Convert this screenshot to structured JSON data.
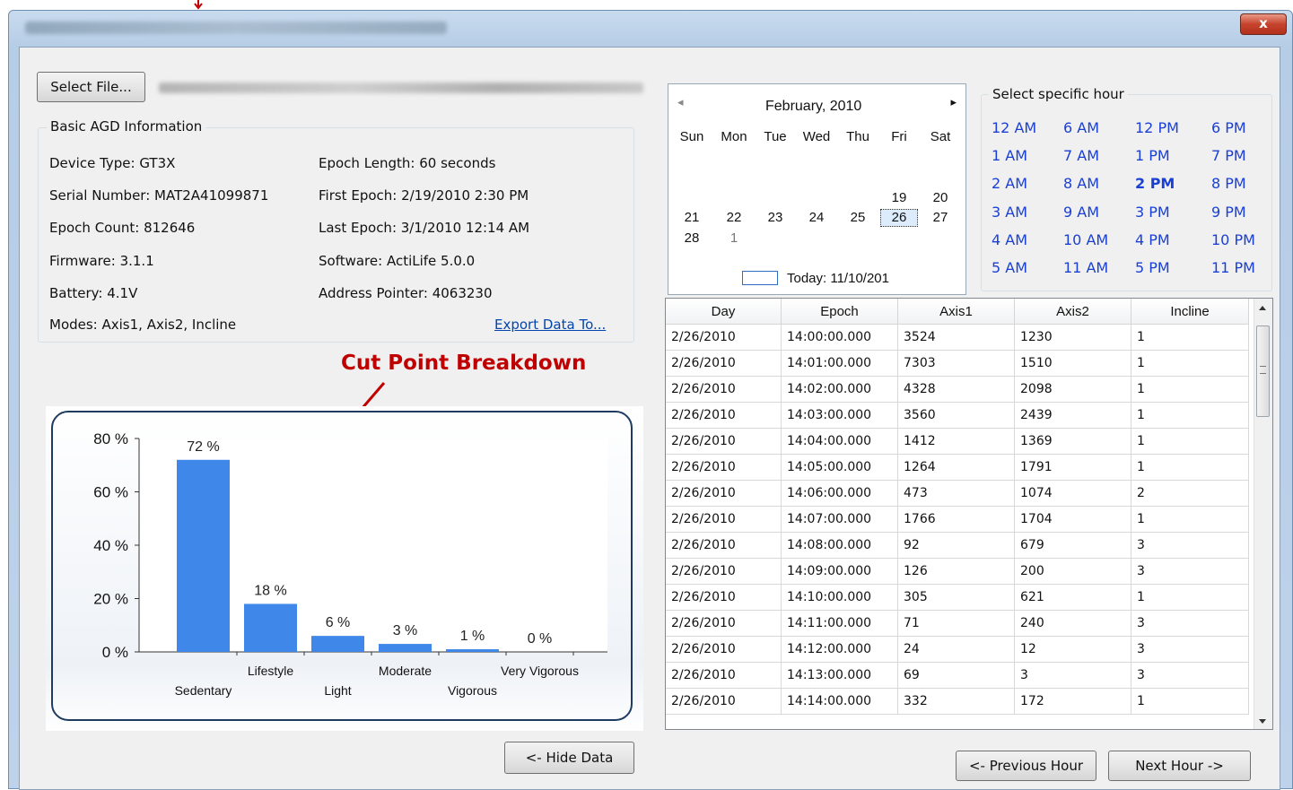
{
  "window": {
    "close_label": "x"
  },
  "file": {
    "select_label": "Select File..."
  },
  "info": {
    "legend": "Basic AGD Information",
    "device_type": "Device Type: GT3X",
    "serial_number": "Serial Number: MAT2A41099871",
    "epoch_count": "Epoch Count: 812646",
    "firmware": "Firmware: 3.1.1",
    "battery": "Battery: 4.1V",
    "modes": "Modes: Axis1, Axis2, Incline",
    "epoch_length": "Epoch Length: 60 seconds",
    "first_epoch": "First Epoch: 2/19/2010 2:30 PM",
    "last_epoch": "Last Epoch: 3/1/2010 12:14 AM",
    "software": "Software: ActiLife 5.0.0",
    "address_pointer": "Address Pointer: 4063230",
    "export_link": "Export Data To..."
  },
  "annotation": "Cut Point Breakdown",
  "chart_data": {
    "type": "bar",
    "categories": [
      "Sedentary",
      "Lifestyle",
      "Light",
      "Moderate",
      "Vigorous",
      "Very Vigorous"
    ],
    "values": [
      72,
      18,
      6,
      3,
      1,
      0
    ],
    "data_labels": [
      "72 %",
      "18 %",
      "6 %",
      "3 %",
      "1 %",
      "0 %"
    ],
    "y_ticks": [
      "0 %",
      "20 %",
      "40 %",
      "60 %",
      "80 %"
    ],
    "ylim": [
      0,
      80
    ],
    "bar_color": "#3f87e8",
    "grid": false
  },
  "calendar": {
    "month_label": "February, 2010",
    "prev_icon": "◂",
    "next_icon": "▸",
    "weekdays": [
      "Sun",
      "Mon",
      "Tue",
      "Wed",
      "Thu",
      "Fri",
      "Sat"
    ],
    "today_label": "Today: 11/10/201",
    "days": [
      "19",
      "20",
      "21",
      "22",
      "23",
      "24",
      "25",
      "26",
      "27",
      "28",
      "1"
    ],
    "selected_day": "26"
  },
  "hours": {
    "legend": "Select specific hour",
    "col1": [
      "12 AM",
      "1 AM",
      "2 AM",
      "3 AM",
      "4 AM",
      "5 AM"
    ],
    "col2": [
      "6 AM",
      "7 AM",
      "8 AM",
      "9 AM",
      "10 AM",
      "11 AM"
    ],
    "col3": [
      "12 PM",
      "1 PM",
      "2 PM",
      "3 PM",
      "4 PM",
      "5 PM"
    ],
    "col4": [
      "6 PM",
      "7 PM",
      "8 PM",
      "9 PM",
      "10 PM",
      "11 PM"
    ],
    "selected": "2 PM",
    "link_color": "#1a3fd4"
  },
  "table": {
    "columns": [
      "Day",
      "Epoch",
      "Axis1",
      "Axis2",
      "Incline"
    ],
    "rows": [
      [
        "2/26/2010",
        "14:00:00.000",
        "3524",
        "1230",
        "1"
      ],
      [
        "2/26/2010",
        "14:01:00.000",
        "7303",
        "1510",
        "1"
      ],
      [
        "2/26/2010",
        "14:02:00.000",
        "4328",
        "2098",
        "1"
      ],
      [
        "2/26/2010",
        "14:03:00.000",
        "3560",
        "2439",
        "1"
      ],
      [
        "2/26/2010",
        "14:04:00.000",
        "1412",
        "1369",
        "1"
      ],
      [
        "2/26/2010",
        "14:05:00.000",
        "1264",
        "1791",
        "1"
      ],
      [
        "2/26/2010",
        "14:06:00.000",
        "473",
        "1074",
        "2"
      ],
      [
        "2/26/2010",
        "14:07:00.000",
        "1766",
        "1704",
        "1"
      ],
      [
        "2/26/2010",
        "14:08:00.000",
        "92",
        "679",
        "3"
      ],
      [
        "2/26/2010",
        "14:09:00.000",
        "126",
        "200",
        "3"
      ],
      [
        "2/26/2010",
        "14:10:00.000",
        "305",
        "621",
        "1"
      ],
      [
        "2/26/2010",
        "14:11:00.000",
        "71",
        "240",
        "3"
      ],
      [
        "2/26/2010",
        "14:12:00.000",
        "24",
        "12",
        "3"
      ],
      [
        "2/26/2010",
        "14:13:00.000",
        "69",
        "3",
        "3"
      ],
      [
        "2/26/2010",
        "14:14:00.000",
        "332",
        "172",
        "1"
      ]
    ]
  },
  "buttons": {
    "hide_data": "<- Hide Data",
    "previous_hour": "<- Previous Hour",
    "next_hour": "Next Hour ->"
  }
}
